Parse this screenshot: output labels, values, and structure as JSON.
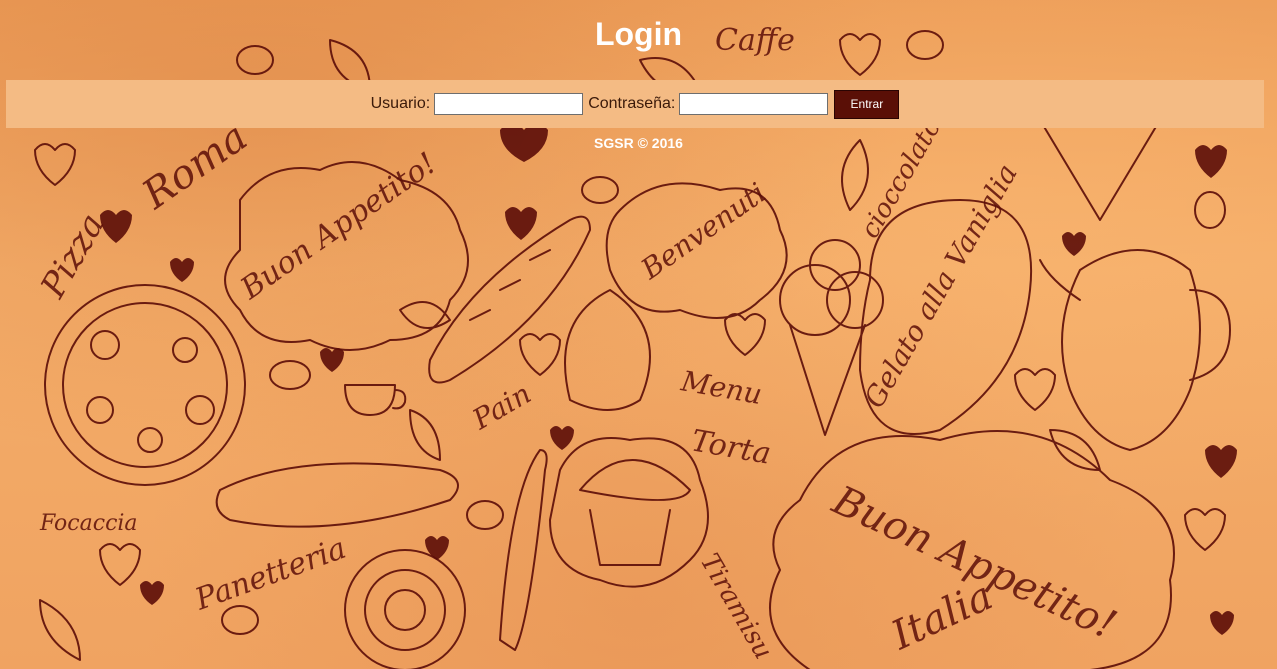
{
  "page": {
    "title": "Login",
    "footer": "SGSR © 2016"
  },
  "login": {
    "user_label": "Usuario:",
    "user_value": "",
    "password_label": "Contraseña:",
    "password_value": "",
    "submit_label": "Entrar"
  },
  "background": {
    "pattern": "hand-drawn italian food doodles",
    "words": [
      "Caffe",
      "Pizza",
      "Roma",
      "Buon Appetito!",
      "Benvenuti",
      "cioccolato",
      "Gelato alla Vaniglia",
      "Menu",
      "Pain",
      "Torta",
      "Focaccia",
      "Panetteria",
      "Tiramisu",
      "Italia"
    ]
  },
  "colors": {
    "background": "#f2a764",
    "doodle": "#5c0d08",
    "bar": "#f4bb84",
    "button": "#5a0f06",
    "text_light": "#ffffff"
  }
}
